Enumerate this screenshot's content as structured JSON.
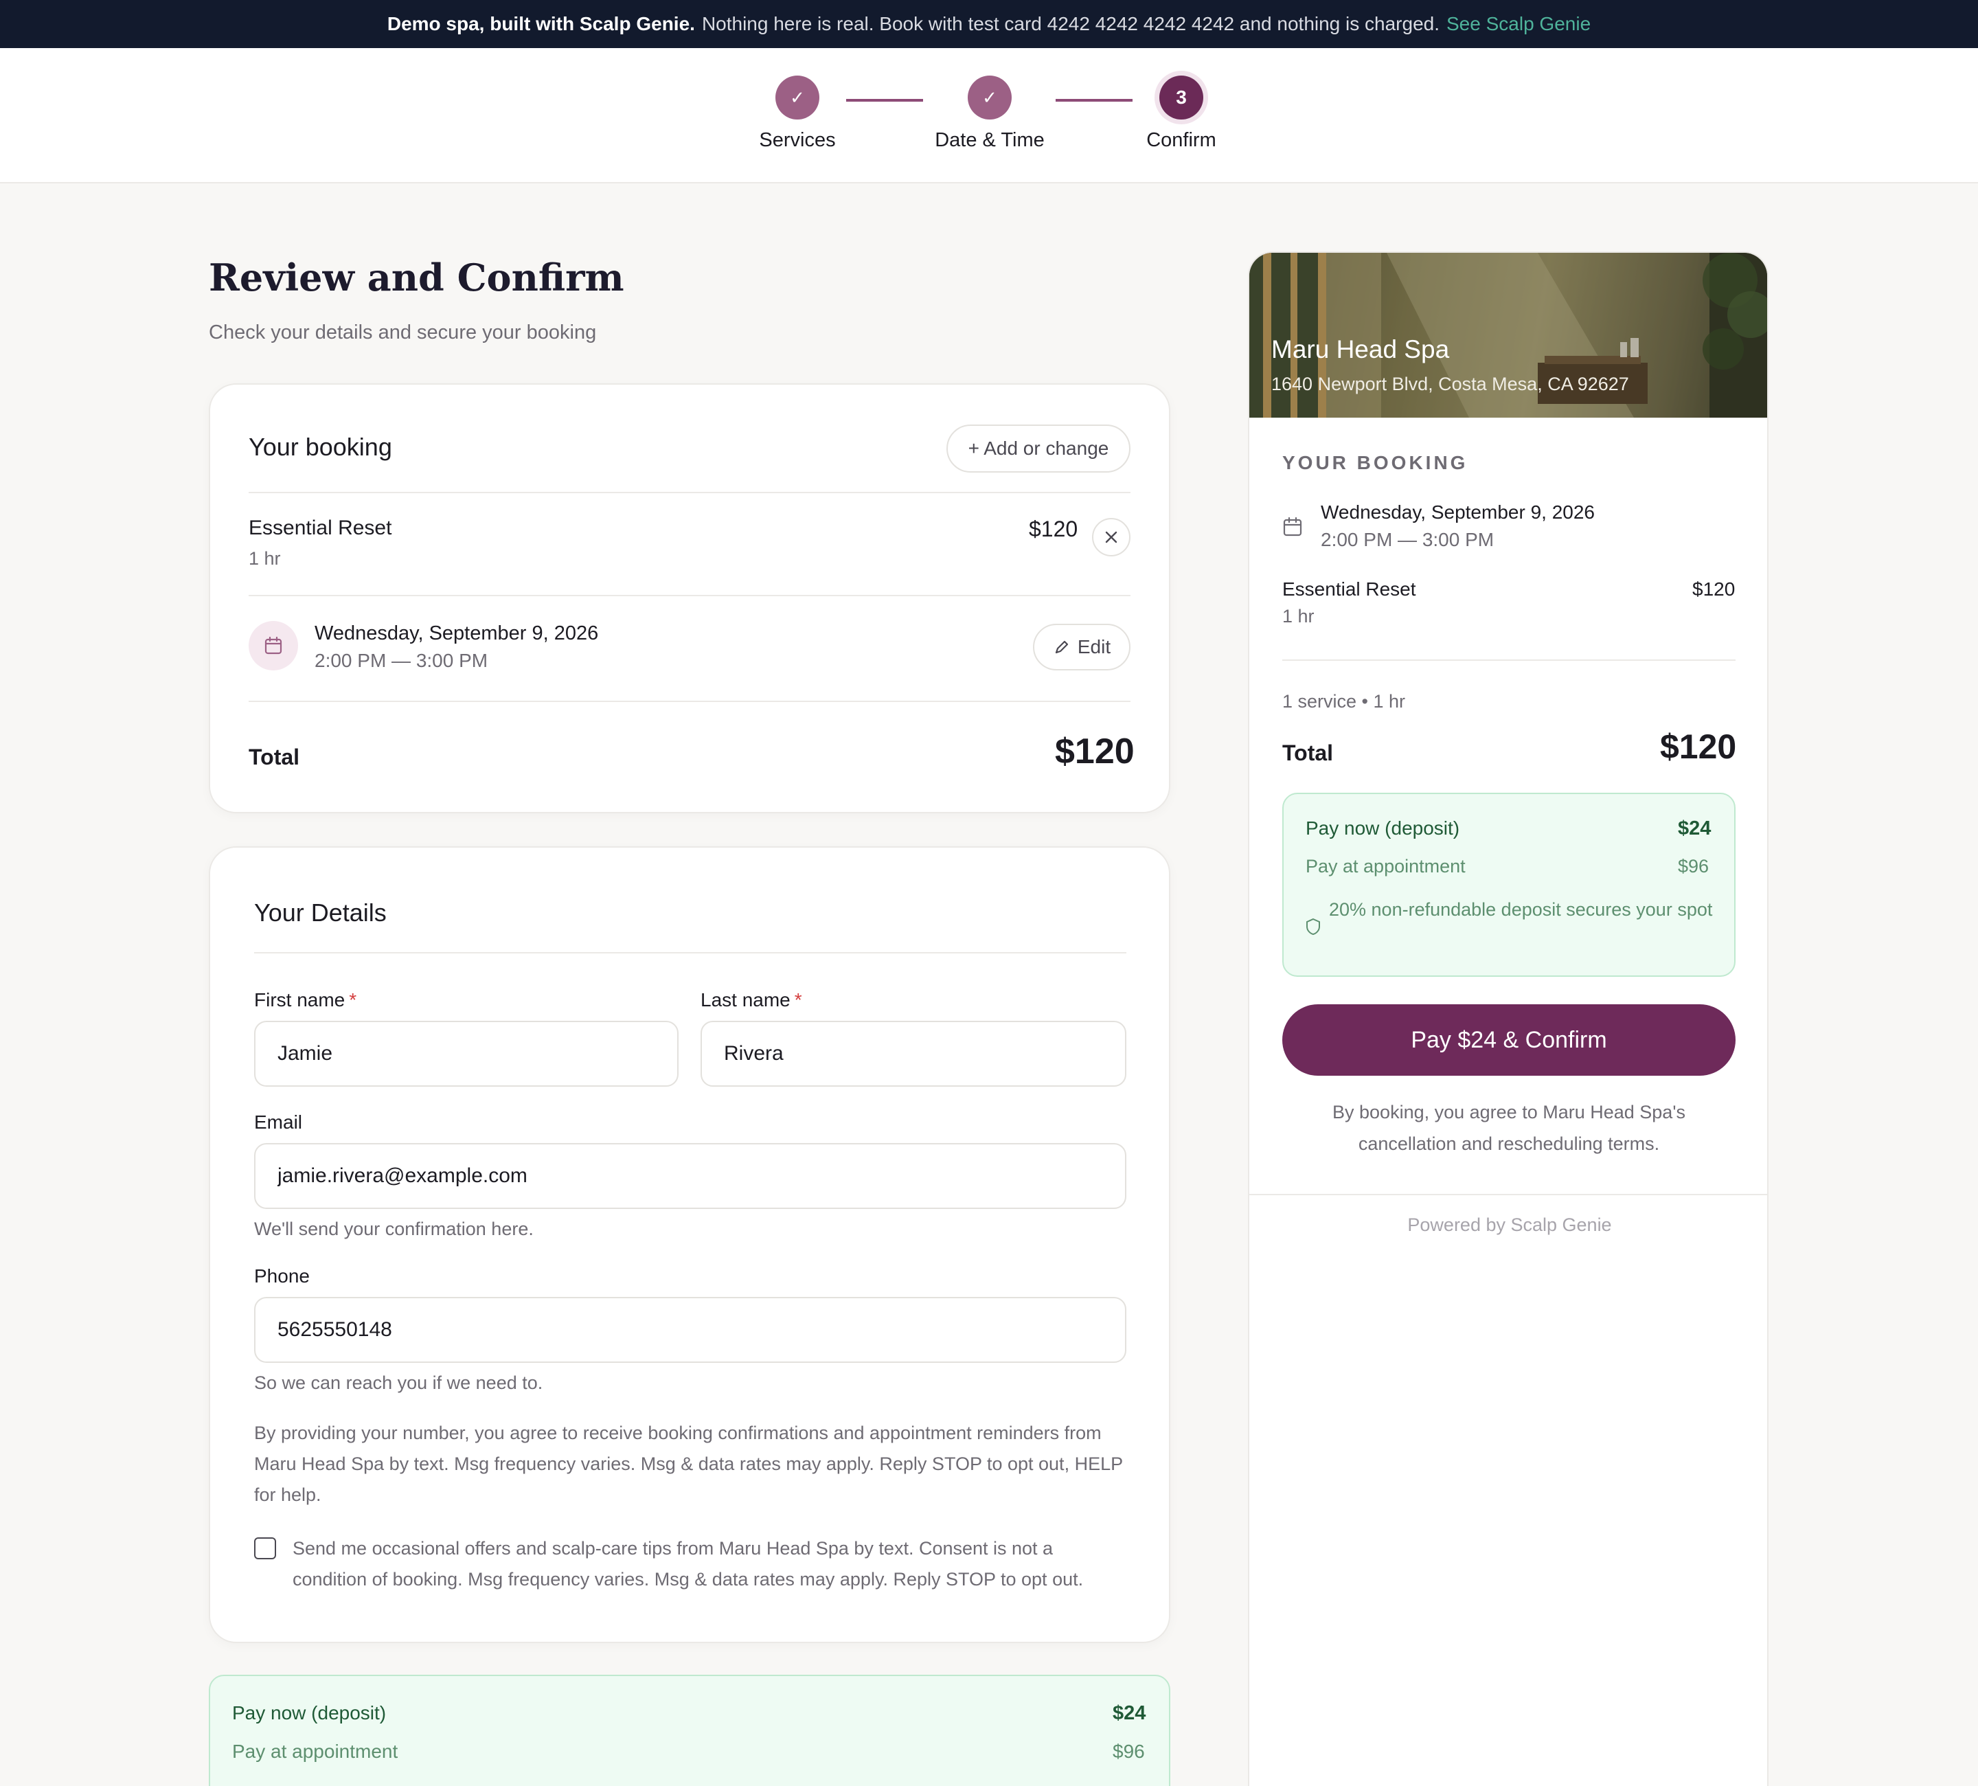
{
  "banner": {
    "strong": "Demo spa, built with Scalp Genie.",
    "text": "Nothing here is real. Book with test card 4242 4242 4242 4242 and nothing is charged.",
    "link": "See Scalp Genie"
  },
  "stepper": {
    "steps": [
      {
        "label": "Services",
        "marker": "✓"
      },
      {
        "label": "Date & Time",
        "marker": "✓"
      },
      {
        "label": "Confirm",
        "marker": "3"
      }
    ]
  },
  "page": {
    "title": "Review and Confirm",
    "subtitle": "Check your details and secure your booking"
  },
  "booking": {
    "title": "Your booking",
    "add_label": "+ Add or change",
    "service_name": "Essential Reset",
    "service_duration": "1 hr",
    "service_price": "$120",
    "date": "Wednesday, September 9, 2026",
    "time": "2:00 PM — 3:00 PM",
    "edit_label": "Edit",
    "total_label": "Total",
    "total_value": "$120"
  },
  "details": {
    "title": "Your Details",
    "first_name_label": "First name",
    "first_name_value": "Jamie",
    "last_name_label": "Last name",
    "last_name_value": "Rivera",
    "required_mark": "*",
    "email_label": "Email",
    "email_value": "jamie.rivera@example.com",
    "email_hint": "We'll send your confirmation here.",
    "phone_label": "Phone",
    "phone_value": "5625550148",
    "phone_hint": "So we can reach you if we need to.",
    "sms_consent": "By providing your number, you agree to receive booking confirmations and appointment reminders from Maru Head Spa by text. Msg frequency varies. Msg & data rates may apply. Reply STOP to opt out, HELP for help.",
    "marketing_optin": "Send me occasional offers and scalp-care tips from Maru Head Spa by text. Consent is not a condition of booking. Msg frequency varies. Msg & data rates may apply. Reply STOP to opt out."
  },
  "payment": {
    "pay_now_label": "Pay now (deposit)",
    "pay_now_value": "$24",
    "pay_later_label": "Pay at appointment",
    "pay_later_value": "$96",
    "deposit_note": "20% non-refundable deposit secures your spot"
  },
  "sidebar": {
    "spa_name": "Maru Head Spa",
    "address": "1640 Newport Blvd, Costa Mesa, CA 92627",
    "eyebrow": "YOUR BOOKING",
    "summary": "1 service • 1 hr",
    "cta_label": "Pay $24 & Confirm",
    "terms": "By booking, you agree to Maru Head Spa's cancellation and rescheduling terms.",
    "powered_by": "Powered by Scalp Genie"
  },
  "colors": {
    "brand": "#6e2a5a",
    "step_done": "#9c6085",
    "banner_bg": "#121a2d",
    "deposit_bg": "#eefbf3"
  }
}
